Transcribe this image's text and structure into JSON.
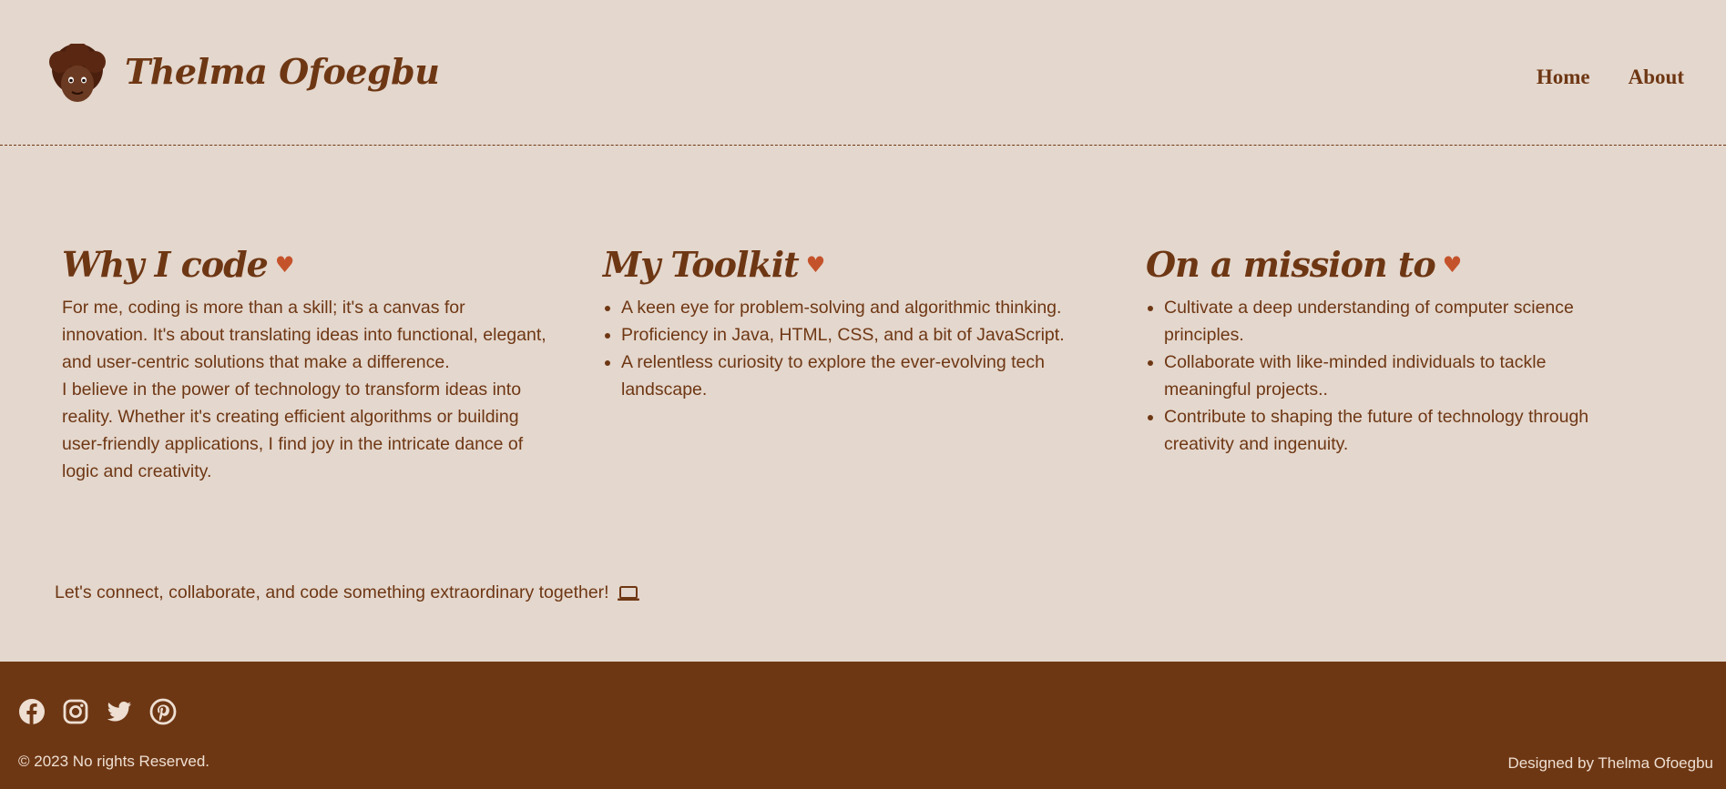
{
  "header": {
    "brand": "Thelma Ofoegbu",
    "nav": [
      "Home",
      "About"
    ]
  },
  "sections": {
    "why": {
      "title": "Why I code",
      "paragraphs": [
        "For me, coding is more than a skill; it's a canvas for innovation. It's about translating ideas into functional, elegant, and user-centric solutions that make a difference.",
        "I believe in the power of technology to transform ideas into reality. Whether it's creating efficient algorithms or building user-friendly applications, I find joy in the intricate dance of logic and creativity."
      ]
    },
    "toolkit": {
      "title": "My Toolkit",
      "items": [
        "A keen eye for problem-solving and algorithmic thinking.",
        "Proficiency in Java, HTML, CSS, and a bit of JavaScript.",
        "A relentless curiosity to explore the ever-evolving tech landscape."
      ]
    },
    "mission": {
      "title": "On a mission to",
      "items": [
        "Cultivate a deep understanding of computer science principles.",
        "Collaborate with like-minded individuals to tackle meaningful projects..",
        "Contribute to shaping the future of technology through creativity and ingenuity."
      ]
    }
  },
  "connect": "Let's connect, collaborate, and code something extraordinary together!",
  "footer": {
    "socials": [
      "facebook-icon",
      "instagram-icon",
      "twitter-icon",
      "pinterest-icon"
    ],
    "copyright": "© 2023 No rights Reserved.",
    "designed_by": "Designed by Thelma Ofoegbu"
  },
  "colors": {
    "background": "#e4d7cd",
    "brown": "#6e3714",
    "heart": "#c4532b",
    "footer_text": "#eedfd2"
  }
}
